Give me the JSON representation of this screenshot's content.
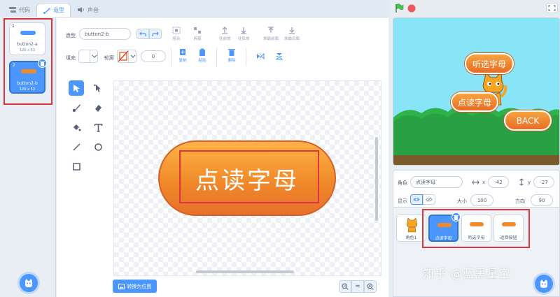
{
  "tabs": [
    {
      "label": "代码",
      "icon": "code-icon"
    },
    {
      "label": "造型",
      "icon": "brush-icon"
    },
    {
      "label": "声音",
      "icon": "speaker-icon"
    }
  ],
  "costumes": [
    {
      "number": "1",
      "name": "button2-a",
      "size": "120 x 53",
      "thumb_text": "点读字母"
    },
    {
      "number": "2",
      "name": "button2-b",
      "size": "120 x 53",
      "thumb_text": "点读字母"
    }
  ],
  "editor": {
    "costume_label": "造型",
    "costume_name": "button2-b",
    "fill_label": "填充",
    "outline_label": "轮廓",
    "outline_width": "0",
    "toolbar": {
      "group": "组合",
      "ungroup": "拆散",
      "forward": "往前放",
      "backward": "往后放",
      "front": "放最前面",
      "back": "放最后面",
      "copy": "复制",
      "paste": "粘贴",
      "delete": "删除"
    },
    "canvas_text": "点读字母",
    "convert_label": "转换为位图",
    "zoom_reset": "="
  },
  "stage": {
    "buttons": {
      "listen": "听选字母",
      "read": "点读字母",
      "back": "BACK"
    }
  },
  "sprite_info": {
    "sprite_label": "角色",
    "sprite_name": "点读字母",
    "x_label": "x",
    "x_value": "-42",
    "y_label": "y",
    "y_value": "-27",
    "show_label": "显示",
    "size_label": "大小",
    "size_value": "100",
    "direction_label": "方向",
    "direction_value": "90"
  },
  "sprites": [
    {
      "name": "角色1",
      "thumb_text": ""
    },
    {
      "name": "点读字母",
      "thumb_text": "点读字母"
    },
    {
      "name": "听选字母",
      "thumb_text": "听选字母"
    },
    {
      "name": "返回按钮",
      "thumb_text": "BACK"
    }
  ],
  "watermark": "知乎 @蓝黑星空",
  "colors": {
    "accent": "#4c97ff",
    "orange": "#f08a2a",
    "highlight": "#e0343f",
    "green_flag": "#4cbf56",
    "stop": "#ec5959"
  }
}
